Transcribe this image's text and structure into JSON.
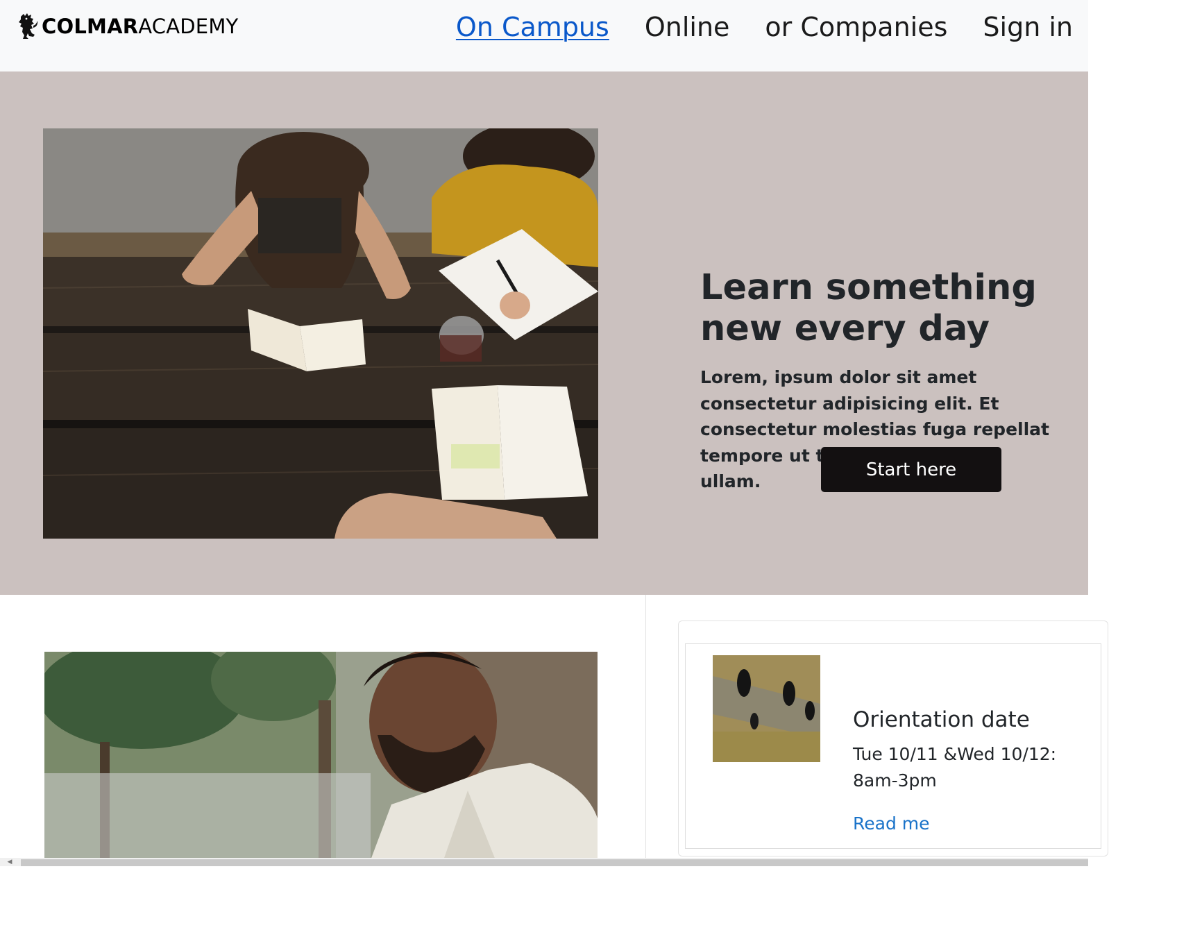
{
  "header": {
    "brand_bold": "COLMAR",
    "brand_light": "ACADEMY",
    "nav": [
      {
        "label": "On Campus",
        "active": true
      },
      {
        "label": "Online",
        "active": false
      },
      {
        "label": "or Companies",
        "active": false
      },
      {
        "label": "Sign in",
        "active": false
      }
    ]
  },
  "hero": {
    "title": "Learn something new every day",
    "subtitle": "Lorem, ipsum dolor sit amet consectetur adipisicing elit. Et consectetur molestias fuga repellat tempore ut tenetur? Tempore, ullam.",
    "cta_label": "Start here",
    "background": "#cbc1bf"
  },
  "event_card": {
    "title": "Orientation date",
    "text": "Tue 10/11 &Wed 10/12: 8am-3pm",
    "link_label": "Read me"
  },
  "colors": {
    "link_active": "#0a58ca",
    "cta_background": "#131011",
    "card_link": "#1a73c9"
  },
  "icons": {
    "logo": "lion-rampant-icon",
    "scroll_left": "scroll-left-arrow-icon"
  }
}
